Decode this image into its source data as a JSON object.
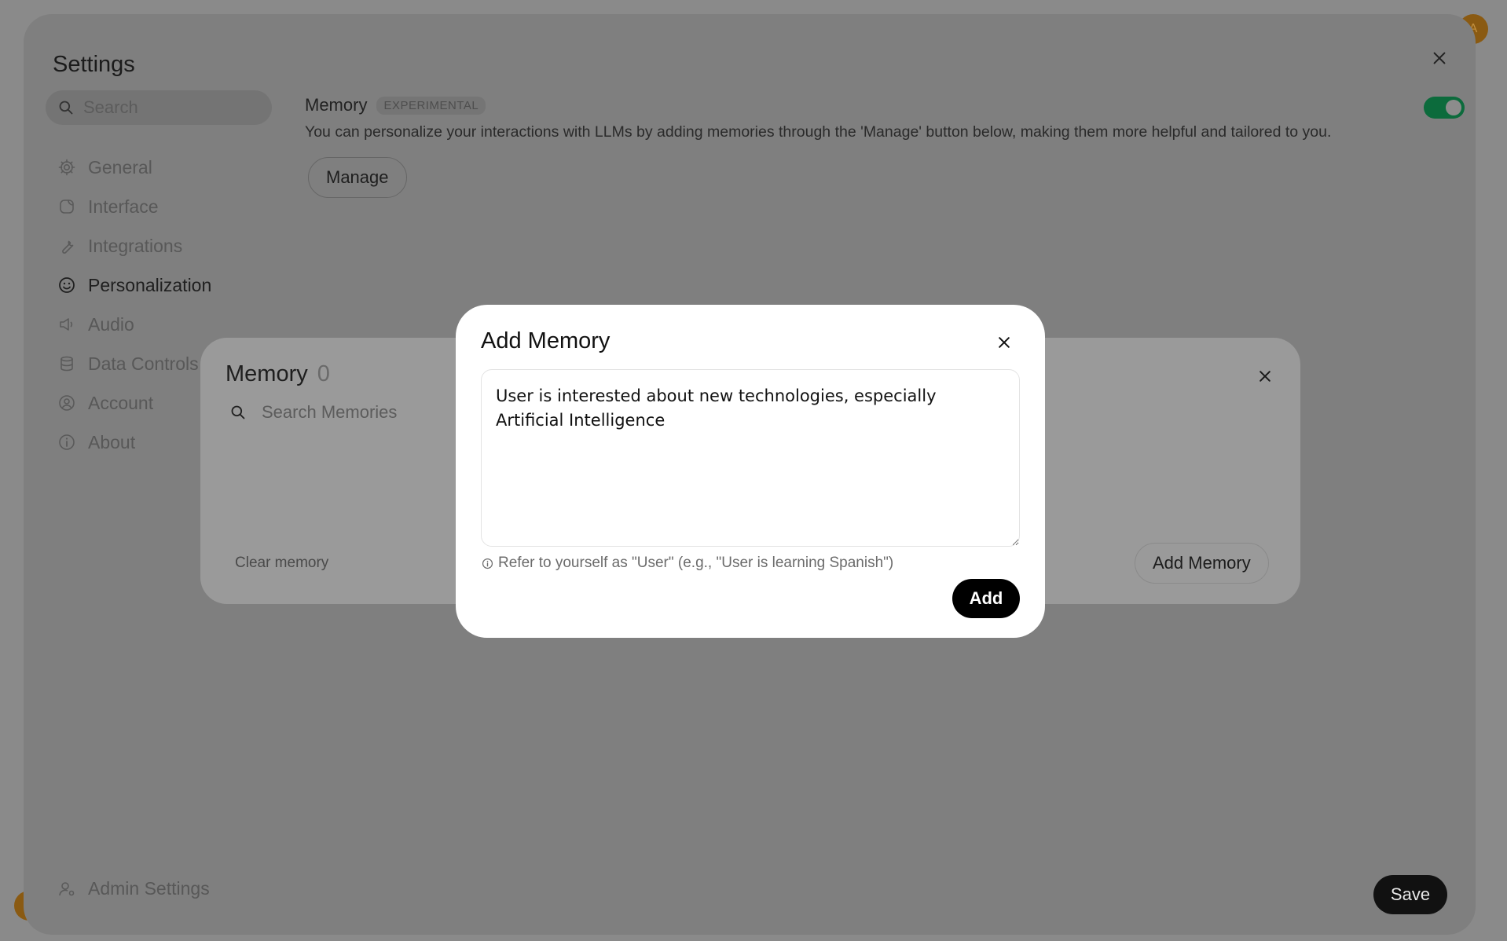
{
  "app": {
    "avatar_initial": "A"
  },
  "settings": {
    "title": "Settings",
    "search_placeholder": "Search",
    "nav": [
      {
        "label": "General",
        "icon": "gear-icon",
        "active": false
      },
      {
        "label": "Interface",
        "icon": "interface-icon",
        "active": false
      },
      {
        "label": "Integrations",
        "icon": "wrench-icon",
        "active": false
      },
      {
        "label": "Personalization",
        "icon": "face-icon",
        "active": true
      },
      {
        "label": "Audio",
        "icon": "speaker-icon",
        "active": false
      },
      {
        "label": "Data Controls",
        "icon": "database-icon",
        "active": false
      },
      {
        "label": "Account",
        "icon": "user-circle-icon",
        "active": false
      },
      {
        "label": "About",
        "icon": "info-icon",
        "active": false
      }
    ],
    "admin_label": "Admin Settings",
    "save_label": "Save",
    "memory": {
      "title": "Memory",
      "badge": "EXPERIMENTAL",
      "enabled": true,
      "description": "You can personalize your interactions with LLMs by adding memories through the 'Manage' button below, making them more helpful and tailored to you.",
      "manage_label": "Manage"
    }
  },
  "memory_modal": {
    "title": "Memory",
    "count": "0",
    "search_placeholder": "Search Memories",
    "clear_label": "Clear memory",
    "add_label": "Add Memory"
  },
  "add_dialog": {
    "title": "Add Memory",
    "text_value": "User is interested about new technologies, especially Artificial Intelligence",
    "hint": "Refer to yourself as \"User\" (e.g., \"User is learning Spanish\")",
    "add_label": "Add"
  },
  "colors": {
    "toggle_on": "#0c6b3c",
    "primary_button": "#000000",
    "avatar": "#8a5a12"
  }
}
